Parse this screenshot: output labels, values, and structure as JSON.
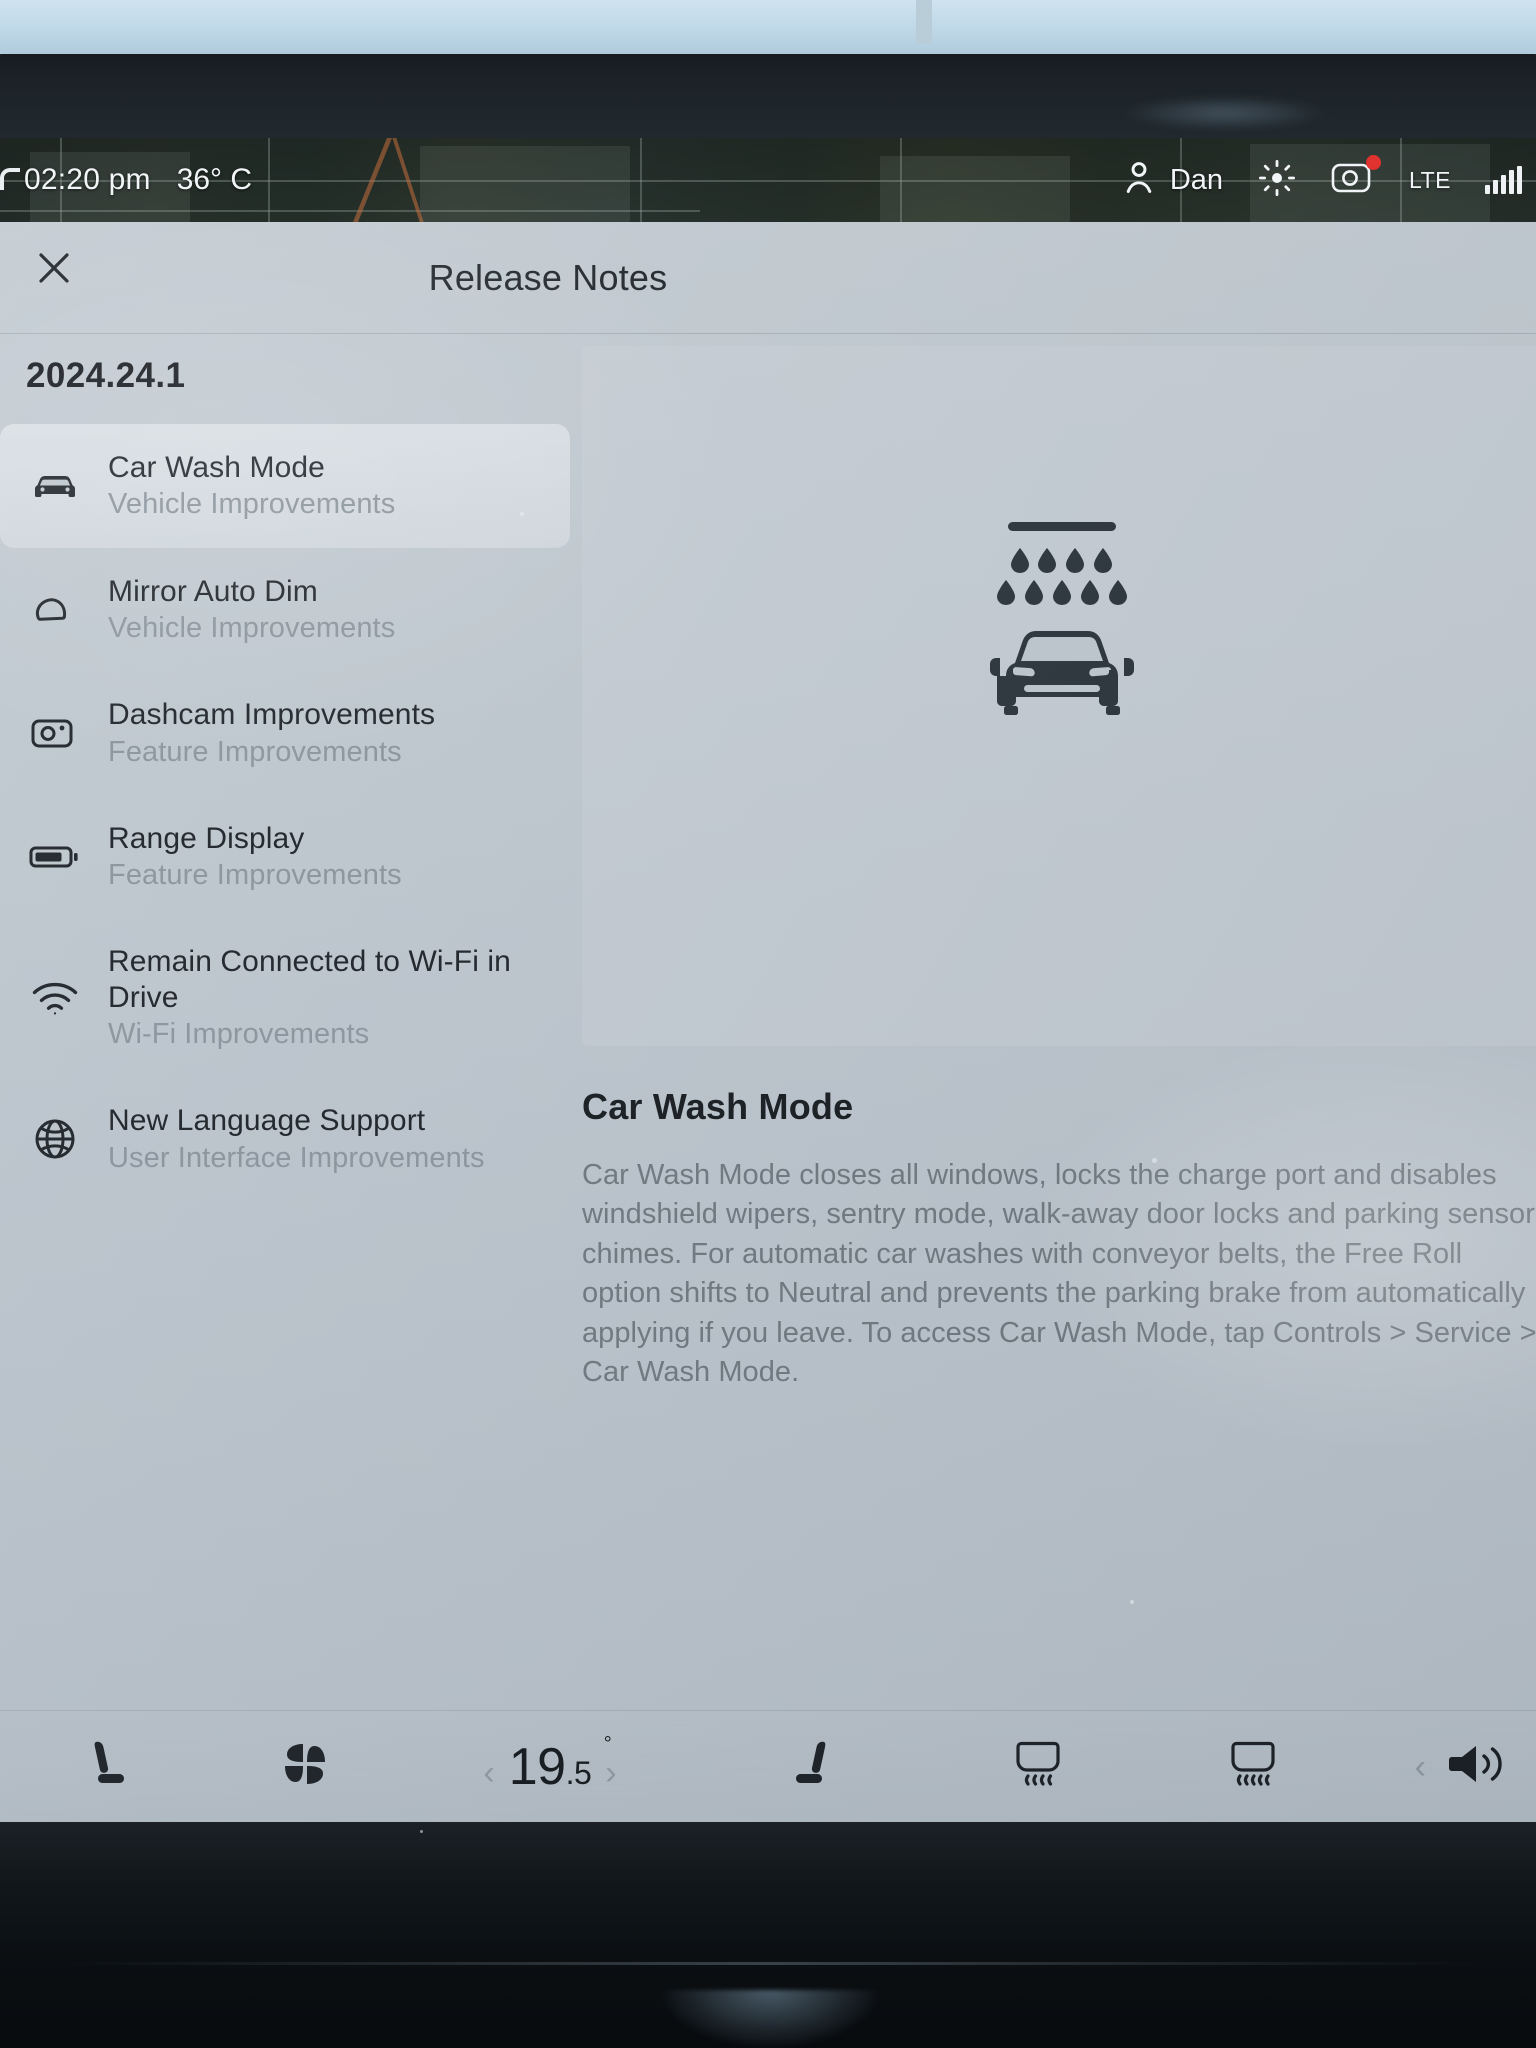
{
  "status_bar": {
    "door_icon": "car-door-open-icon",
    "time": "02:20 pm",
    "temperature": "36° C",
    "profile_icon": "person-icon",
    "profile_name": "Dan",
    "brightness_icon": "brightness-sun-icon",
    "dashcam_icon": "dashcam-camera-icon",
    "dashcam_recording": true,
    "network_label": "LTE",
    "signal_icon": "signal-bars-icon"
  },
  "header": {
    "close_icon": "close-x-icon",
    "title": "Release Notes"
  },
  "sidebar": {
    "version": "2024.24.1",
    "items": [
      {
        "icon": "car-front-icon",
        "title": "Car Wash Mode",
        "subtitle": "Vehicle Improvements",
        "active": true
      },
      {
        "icon": "mirror-icon",
        "title": "Mirror Auto Dim",
        "subtitle": "Vehicle Improvements",
        "active": false
      },
      {
        "icon": "dashcam-icon",
        "title": "Dashcam Improvements",
        "subtitle": "Feature Improvements",
        "active": false
      },
      {
        "icon": "battery-icon",
        "title": "Range Display",
        "subtitle": "Feature Improvements",
        "active": false
      },
      {
        "icon": "wifi-icon",
        "title": "Remain Connected to Wi-Fi in Drive",
        "subtitle": "Wi-Fi Improvements",
        "active": false
      },
      {
        "icon": "globe-icon",
        "title": "New Language Support",
        "subtitle": "User Interface Improvements",
        "active": false
      }
    ]
  },
  "detail": {
    "illustration": "car-wash-icon",
    "title": "Car Wash Mode",
    "body": "Car Wash Mode closes all windows, locks the charge port and disables windshield wipers, sentry mode, walk-away door locks and parking sensor chimes. For automatic car washes with conveyor belts, the Free Roll option shifts to Neutral and prevents the parking brake from automatically applying if you leave. To access Car Wash Mode, tap Controls > Service > Car Wash Mode."
  },
  "climate": {
    "seat_left_icon": "seat-heater-left-icon",
    "fan_icon": "fan-icon",
    "temp_prev_icon": "chevron-left-icon",
    "temp_whole": "19",
    "temp_decimal": ".5",
    "temp_degree": "°",
    "temp_next_icon": "chevron-right-icon",
    "seat_right_icon": "seat-heater-right-icon",
    "defrost_front_icon": "defrost-front-icon",
    "defrost_rear_icon": "defrost-rear-icon",
    "volume_prev_icon": "chevron-left-icon",
    "volume_icon": "speaker-volume-icon"
  },
  "colors": {
    "panel_bg": "#bec7cf",
    "text_primary": "#1c2228",
    "text_muted": "#8b949d",
    "body_text": "#6f7880",
    "rec_dot": "#e0322f",
    "status_text": "#f2f5f7"
  }
}
